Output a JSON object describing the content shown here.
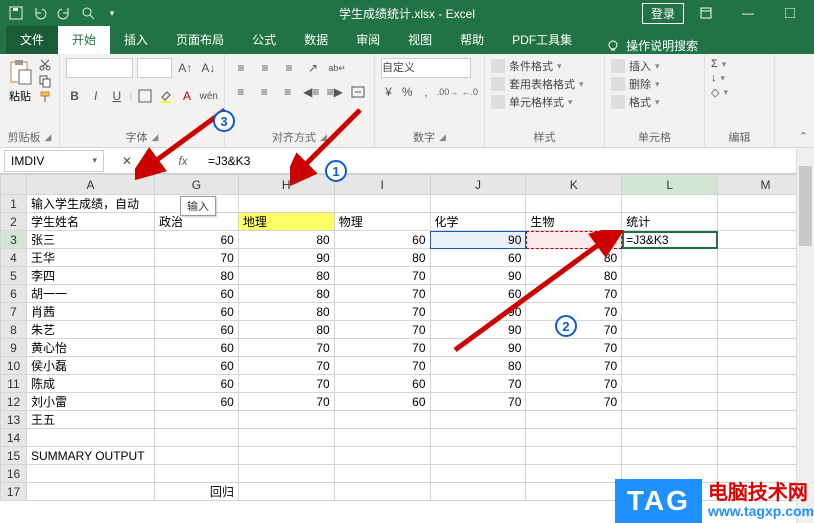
{
  "titlebar": {
    "filename": "学生成绩统计.xlsx - Excel",
    "login": "登录"
  },
  "tabs": {
    "file": "文件",
    "home": "开始",
    "insert": "插入",
    "pagelayout": "页面布局",
    "formulas": "公式",
    "data": "数据",
    "review": "审阅",
    "view": "视图",
    "help": "帮助",
    "pdf": "PDF工具集",
    "tellme": "操作说明搜索"
  },
  "ribbon": {
    "clipboard": {
      "label": "剪贴板",
      "paste": "粘贴"
    },
    "font": {
      "label": "字体"
    },
    "alignment": {
      "label": "对齐方式"
    },
    "number": {
      "label": "数字",
      "custom": "自定义"
    },
    "styles": {
      "label": "样式",
      "conditional": "条件格式",
      "as_table": "套用表格格式",
      "cell_styles": "单元格样式"
    },
    "cells": {
      "label": "单元格",
      "insert": "插入",
      "delete": "删除",
      "format": "格式"
    },
    "editing": {
      "label": "编辑"
    }
  },
  "formula_bar": {
    "name_box": "IMDIV",
    "formula": "=J3&K3",
    "tooltip": "输入"
  },
  "annotations": {
    "m1": "1",
    "m2": "2",
    "m3": "3"
  },
  "columns": [
    "A",
    "G",
    "H",
    "I",
    "J",
    "K",
    "L",
    "M"
  ],
  "row_labels": [
    "1",
    "2",
    "3",
    "4",
    "5",
    "6",
    "7",
    "8",
    "9",
    "10",
    "11",
    "12",
    "13",
    "14",
    "15",
    "16",
    "17"
  ],
  "cells": {
    "a1": "输入学生成绩，自动",
    "a2": "学生姓名",
    "g2": "政治",
    "h2": "地理",
    "i2": "物理",
    "j2": "化学",
    "k2": "生物",
    "l2": "统计",
    "a3": "张三",
    "g3": "60",
    "h3": "80",
    "i3": "60",
    "j3": "90",
    "k3": "80",
    "l3": "=J3&K3",
    "a4": "王华",
    "g4": "70",
    "h4": "90",
    "i4": "80",
    "j4": "60",
    "k4": "80",
    "a5": "李四",
    "g5": "80",
    "h5": "80",
    "i5": "70",
    "j5": "90",
    "k5": "80",
    "a6": "胡一一",
    "g6": "60",
    "h6": "80",
    "i6": "70",
    "j6": "60",
    "k6": "70",
    "a7": "肖茜",
    "g7": "60",
    "h7": "80",
    "i7": "70",
    "j7": "90",
    "k7": "70",
    "a8": "朱艺",
    "g8": "60",
    "h8": "80",
    "i8": "70",
    "j8": "90",
    "k8": "70",
    "a9": "黄心怡",
    "g9": "60",
    "h9": "70",
    "i9": "70",
    "j9": "90",
    "k9": "70",
    "a10": "侯小磊",
    "g10": "60",
    "h10": "70",
    "i10": "70",
    "j10": "80",
    "k10": "70",
    "a11": "陈成",
    "g11": "60",
    "h11": "70",
    "i11": "60",
    "j11": "70",
    "k11": "70",
    "a12": "刘小雷",
    "g12": "60",
    "h12": "70",
    "i12": "60",
    "j12": "70",
    "k12": "70",
    "a13": "王五",
    "a15": "SUMMARY OUTPUT",
    "g17": "回归"
  },
  "watermark": {
    "tag": "TAG",
    "cn": "电脑技术网",
    "url": "www.tagxp.com"
  }
}
